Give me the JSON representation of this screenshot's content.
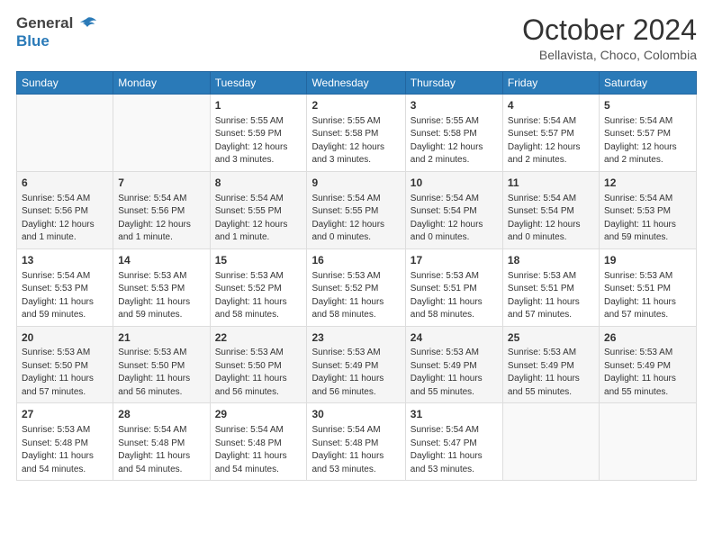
{
  "logo": {
    "line1": "General",
    "line2": "Blue"
  },
  "title": "October 2024",
  "subtitle": "Bellavista, Choco, Colombia",
  "days_of_week": [
    "Sunday",
    "Monday",
    "Tuesday",
    "Wednesday",
    "Thursday",
    "Friday",
    "Saturday"
  ],
  "weeks": [
    [
      {
        "day": "",
        "info": ""
      },
      {
        "day": "",
        "info": ""
      },
      {
        "day": "1",
        "info": "Sunrise: 5:55 AM\nSunset: 5:59 PM\nDaylight: 12 hours\nand 3 minutes."
      },
      {
        "day": "2",
        "info": "Sunrise: 5:55 AM\nSunset: 5:58 PM\nDaylight: 12 hours\nand 3 minutes."
      },
      {
        "day": "3",
        "info": "Sunrise: 5:55 AM\nSunset: 5:58 PM\nDaylight: 12 hours\nand 2 minutes."
      },
      {
        "day": "4",
        "info": "Sunrise: 5:54 AM\nSunset: 5:57 PM\nDaylight: 12 hours\nand 2 minutes."
      },
      {
        "day": "5",
        "info": "Sunrise: 5:54 AM\nSunset: 5:57 PM\nDaylight: 12 hours\nand 2 minutes."
      }
    ],
    [
      {
        "day": "6",
        "info": "Sunrise: 5:54 AM\nSunset: 5:56 PM\nDaylight: 12 hours\nand 1 minute."
      },
      {
        "day": "7",
        "info": "Sunrise: 5:54 AM\nSunset: 5:56 PM\nDaylight: 12 hours\nand 1 minute."
      },
      {
        "day": "8",
        "info": "Sunrise: 5:54 AM\nSunset: 5:55 PM\nDaylight: 12 hours\nand 1 minute."
      },
      {
        "day": "9",
        "info": "Sunrise: 5:54 AM\nSunset: 5:55 PM\nDaylight: 12 hours\nand 0 minutes."
      },
      {
        "day": "10",
        "info": "Sunrise: 5:54 AM\nSunset: 5:54 PM\nDaylight: 12 hours\nand 0 minutes."
      },
      {
        "day": "11",
        "info": "Sunrise: 5:54 AM\nSunset: 5:54 PM\nDaylight: 12 hours\nand 0 minutes."
      },
      {
        "day": "12",
        "info": "Sunrise: 5:54 AM\nSunset: 5:53 PM\nDaylight: 11 hours\nand 59 minutes."
      }
    ],
    [
      {
        "day": "13",
        "info": "Sunrise: 5:54 AM\nSunset: 5:53 PM\nDaylight: 11 hours\nand 59 minutes."
      },
      {
        "day": "14",
        "info": "Sunrise: 5:53 AM\nSunset: 5:53 PM\nDaylight: 11 hours\nand 59 minutes."
      },
      {
        "day": "15",
        "info": "Sunrise: 5:53 AM\nSunset: 5:52 PM\nDaylight: 11 hours\nand 58 minutes."
      },
      {
        "day": "16",
        "info": "Sunrise: 5:53 AM\nSunset: 5:52 PM\nDaylight: 11 hours\nand 58 minutes."
      },
      {
        "day": "17",
        "info": "Sunrise: 5:53 AM\nSunset: 5:51 PM\nDaylight: 11 hours\nand 58 minutes."
      },
      {
        "day": "18",
        "info": "Sunrise: 5:53 AM\nSunset: 5:51 PM\nDaylight: 11 hours\nand 57 minutes."
      },
      {
        "day": "19",
        "info": "Sunrise: 5:53 AM\nSunset: 5:51 PM\nDaylight: 11 hours\nand 57 minutes."
      }
    ],
    [
      {
        "day": "20",
        "info": "Sunrise: 5:53 AM\nSunset: 5:50 PM\nDaylight: 11 hours\nand 57 minutes."
      },
      {
        "day": "21",
        "info": "Sunrise: 5:53 AM\nSunset: 5:50 PM\nDaylight: 11 hours\nand 56 minutes."
      },
      {
        "day": "22",
        "info": "Sunrise: 5:53 AM\nSunset: 5:50 PM\nDaylight: 11 hours\nand 56 minutes."
      },
      {
        "day": "23",
        "info": "Sunrise: 5:53 AM\nSunset: 5:49 PM\nDaylight: 11 hours\nand 56 minutes."
      },
      {
        "day": "24",
        "info": "Sunrise: 5:53 AM\nSunset: 5:49 PM\nDaylight: 11 hours\nand 55 minutes."
      },
      {
        "day": "25",
        "info": "Sunrise: 5:53 AM\nSunset: 5:49 PM\nDaylight: 11 hours\nand 55 minutes."
      },
      {
        "day": "26",
        "info": "Sunrise: 5:53 AM\nSunset: 5:49 PM\nDaylight: 11 hours\nand 55 minutes."
      }
    ],
    [
      {
        "day": "27",
        "info": "Sunrise: 5:53 AM\nSunset: 5:48 PM\nDaylight: 11 hours\nand 54 minutes."
      },
      {
        "day": "28",
        "info": "Sunrise: 5:54 AM\nSunset: 5:48 PM\nDaylight: 11 hours\nand 54 minutes."
      },
      {
        "day": "29",
        "info": "Sunrise: 5:54 AM\nSunset: 5:48 PM\nDaylight: 11 hours\nand 54 minutes."
      },
      {
        "day": "30",
        "info": "Sunrise: 5:54 AM\nSunset: 5:48 PM\nDaylight: 11 hours\nand 53 minutes."
      },
      {
        "day": "31",
        "info": "Sunrise: 5:54 AM\nSunset: 5:47 PM\nDaylight: 11 hours\nand 53 minutes."
      },
      {
        "day": "",
        "info": ""
      },
      {
        "day": "",
        "info": ""
      }
    ]
  ]
}
